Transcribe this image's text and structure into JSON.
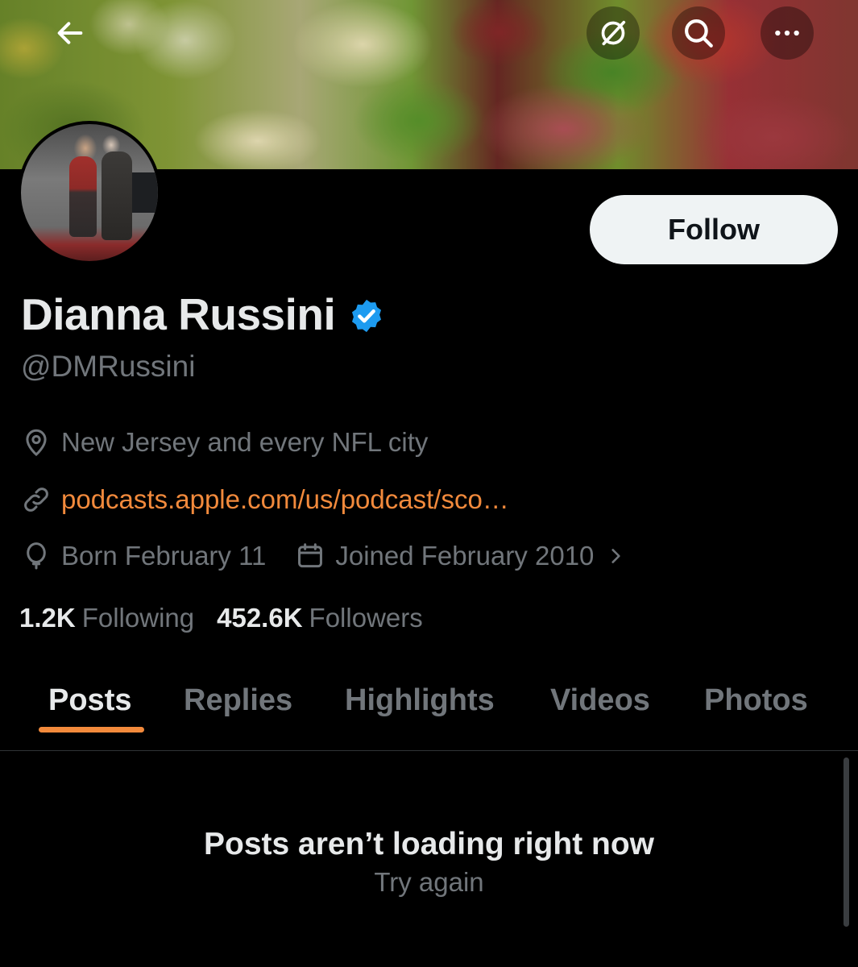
{
  "header": {
    "back_icon": "arrow-left-icon",
    "grok_icon": "grok-icon",
    "search_icon": "search-icon",
    "more_icon": "more-horizontal-icon"
  },
  "profile": {
    "name": "Dianna Russini",
    "handle": "@DMRussini",
    "verified": true,
    "follow_label": "Follow",
    "location": "New Jersey and every NFL city",
    "link": "podcasts.apple.com/us/podcast/sco…",
    "born": "Born February 11",
    "joined": "Joined February 2010",
    "following_count": "1.2K",
    "following_label": "Following",
    "followers_count": "452.6K",
    "followers_label": "Followers"
  },
  "tabs": [
    {
      "label": "Posts",
      "active": true
    },
    {
      "label": "Replies",
      "active": false
    },
    {
      "label": "Highlights",
      "active": false
    },
    {
      "label": "Videos",
      "active": false
    },
    {
      "label": "Photos",
      "active": false
    }
  ],
  "feed": {
    "error_title": "Posts aren’t loading right now",
    "retry_label": "Try again"
  },
  "colors": {
    "accent": "#f28a3c",
    "verified_blue": "#1d9bf0",
    "muted_text": "#71767b"
  }
}
